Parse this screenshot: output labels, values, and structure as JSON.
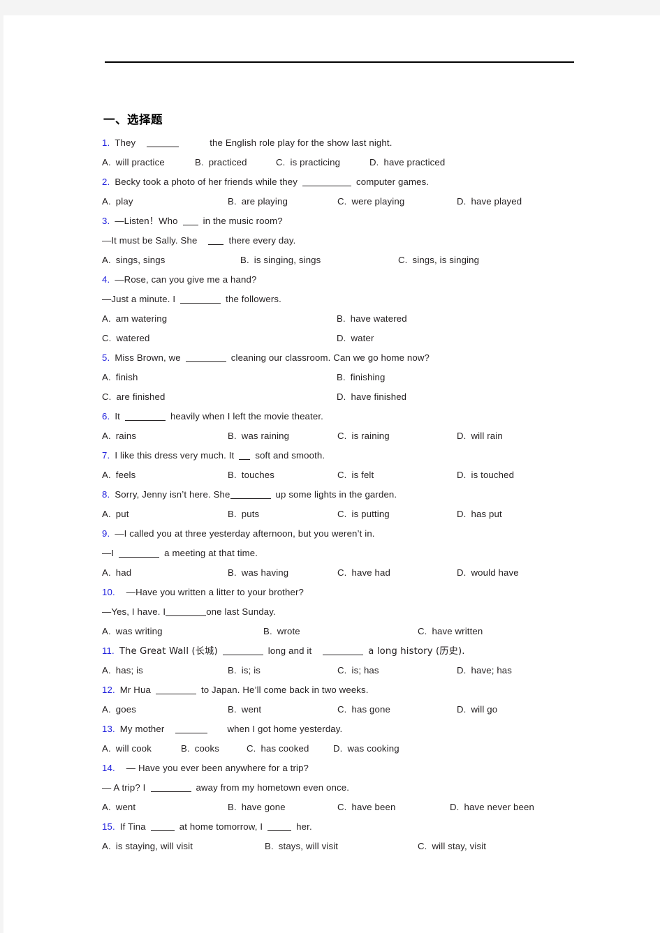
{
  "document": {
    "section_title": "一、选择题",
    "header_rule": true
  },
  "questions": [
    {
      "number": "1.",
      "stem_before": "They",
      "stem_after": "the English role play for the show last night.",
      "options": [
        {
          "label": "A.",
          "text": "will practice"
        },
        {
          "label": "B.",
          "text": "practiced"
        },
        {
          "label": "C.",
          "text": "is practicing"
        },
        {
          "label": "D.",
          "text": "have practiced"
        }
      ]
    },
    {
      "number": "2.",
      "stem_before": "Becky took a photo of her friends while they",
      "stem_after": "computer games.",
      "options": [
        {
          "label": "A.",
          "text": "play"
        },
        {
          "label": "B.",
          "text": "are playing"
        },
        {
          "label": "C.",
          "text": "were playing"
        },
        {
          "label": "D.",
          "text": "have played"
        }
      ]
    },
    {
      "number": "3.",
      "stem_before": "—Listen！Who",
      "stem_after": "in the music room?",
      "stem_line2_before": "—It must be Sally. She",
      "stem_line2_after": "there every day.",
      "options": [
        {
          "label": "A.",
          "text": "sings, sings"
        },
        {
          "label": "B.",
          "text": "is singing, sings"
        },
        {
          "label": "C.",
          "text": "sings, is singing"
        }
      ]
    },
    {
      "number": "4.",
      "stem_line1": "—Rose, can you give me a hand?",
      "stem_line2_before": "—Just a minute. I",
      "stem_line2_after": "the followers.",
      "options": [
        {
          "label": "A.",
          "text": "am watering"
        },
        {
          "label": "B.",
          "text": "have watered"
        },
        {
          "label": "C.",
          "text": "watered"
        },
        {
          "label": "D.",
          "text": "water"
        }
      ]
    },
    {
      "number": "5.",
      "stem_before": "Miss Brown, we",
      "stem_after": "cleaning our classroom. Can we go home now?",
      "options": [
        {
          "label": "A.",
          "text": "finish"
        },
        {
          "label": "B.",
          "text": "finishing"
        },
        {
          "label": "C.",
          "text": "are finished"
        },
        {
          "label": "D.",
          "text": "have finished"
        }
      ]
    },
    {
      "number": "6.",
      "stem_before": "It",
      "stem_after": "heavily when I left the movie theater.",
      "options": [
        {
          "label": "A.",
          "text": "rains"
        },
        {
          "label": "B.",
          "text": "was raining"
        },
        {
          "label": "C.",
          "text": "is raining"
        },
        {
          "label": "D.",
          "text": "will rain"
        }
      ]
    },
    {
      "number": "7.",
      "stem_before": "I like this dress very much. It",
      "stem_after": "soft and smooth.",
      "options": [
        {
          "label": "A.",
          "text": "feels"
        },
        {
          "label": "B.",
          "text": "touches"
        },
        {
          "label": "C.",
          "text": "is felt"
        },
        {
          "label": "D.",
          "text": "is touched"
        }
      ]
    },
    {
      "number": "8.",
      "stem_before": "Sorry, Jenny isn’t here. She",
      "stem_after": "up some lights in the garden.",
      "options": [
        {
          "label": "A.",
          "text": "put"
        },
        {
          "label": "B.",
          "text": "puts"
        },
        {
          "label": "C.",
          "text": "is putting"
        },
        {
          "label": "D.",
          "text": "has put"
        }
      ]
    },
    {
      "number": "9.",
      "stem_line1": "—I called you at three yesterday afternoon, but you weren’t in.",
      "stem_line2_before": "—I",
      "stem_line2_after": "a meeting at that time.",
      "options": [
        {
          "label": "A.",
          "text": "had"
        },
        {
          "label": "B.",
          "text": "was having"
        },
        {
          "label": "C.",
          "text": "have had"
        },
        {
          "label": "D.",
          "text": "would have"
        }
      ]
    },
    {
      "number": "10.",
      "stem_line1": "—Have you written a litter to your brother?",
      "stem_line2_before": "—Yes, I have. I",
      "stem_line2_after": "one last Sunday.",
      "options": [
        {
          "label": "A.",
          "text": "was writing"
        },
        {
          "label": "B.",
          "text": "wrote"
        },
        {
          "label": "C.",
          "text": "have written"
        }
      ]
    },
    {
      "number": "11.",
      "stem_before": "The Great Wall (长城)",
      "stem_mid": "long and it",
      "stem_after": "a long history (历史).",
      "options": [
        {
          "label": "A.",
          "text": "has; is"
        },
        {
          "label": "B.",
          "text": "is; is"
        },
        {
          "label": "C.",
          "text": "is; has"
        },
        {
          "label": "D.",
          "text": "have; has"
        }
      ]
    },
    {
      "number": "12.",
      "stem_before": "Mr Hua",
      "stem_after": "to Japan. He’ll come back in two weeks.",
      "options": [
        {
          "label": "A.",
          "text": "goes"
        },
        {
          "label": "B.",
          "text": "went"
        },
        {
          "label": "C.",
          "text": "has gone"
        },
        {
          "label": "D.",
          "text": "will go"
        }
      ]
    },
    {
      "number": "13.",
      "stem_before": "My mother",
      "stem_after": "when I got home yesterday.",
      "options": [
        {
          "label": "A.",
          "text": "will cook"
        },
        {
          "label": "B.",
          "text": "cooks"
        },
        {
          "label": "C.",
          "text": "has cooked"
        },
        {
          "label": "D.",
          "text": "was cooking"
        }
      ]
    },
    {
      "number": "14.",
      "stem_line1": "— Have you ever been anywhere for a trip?",
      "stem_line2_before": "— A trip? I",
      "stem_line2_after": "away from my hometown even once.",
      "options": [
        {
          "label": "A.",
          "text": "went"
        },
        {
          "label": "B.",
          "text": "have gone"
        },
        {
          "label": "C.",
          "text": "have been"
        },
        {
          "label": "D.",
          "text": "have never been"
        }
      ]
    },
    {
      "number": "15.",
      "stem_before": "If Tina",
      "stem_mid": "at home tomorrow, I",
      "stem_after": "her.",
      "options": [
        {
          "label": "A.",
          "text": "is staying, will visit"
        },
        {
          "label": "B.",
          "text": "stays, will visit"
        },
        {
          "label": "C.",
          "text": "will stay, visit"
        }
      ]
    }
  ],
  "colors": {
    "question_number": "#2222dd",
    "body_text": "#231f20",
    "page_background": "#ffffff",
    "band_background": "#f4f4f4"
  }
}
